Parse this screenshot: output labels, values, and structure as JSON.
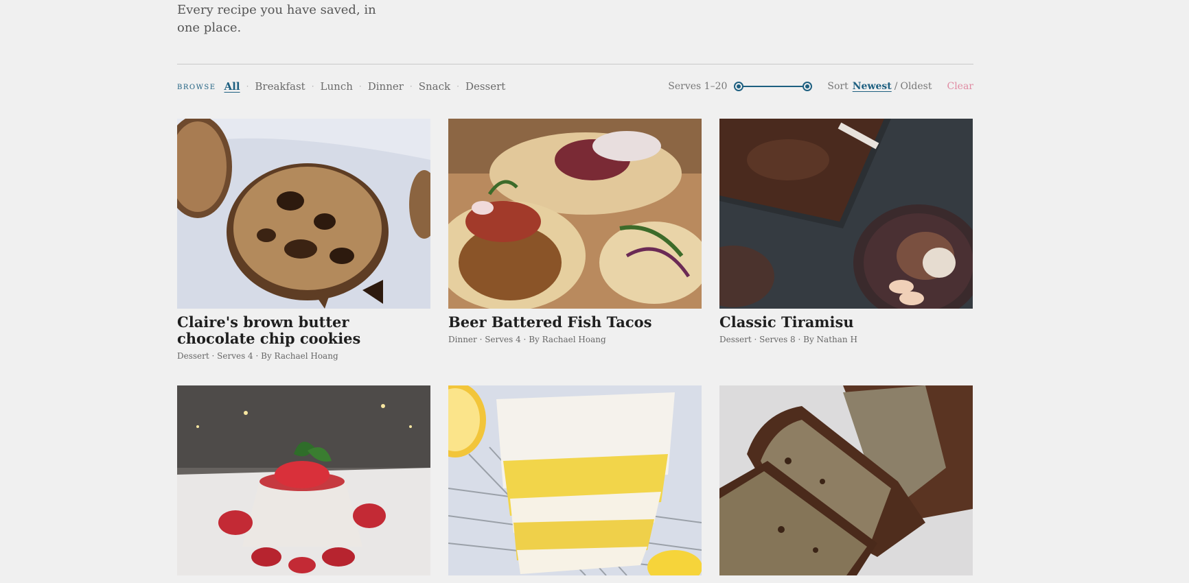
{
  "intro": {
    "text": "Every recipe you have saved, in one place."
  },
  "filters": {
    "browse_label": "Browse",
    "categories": [
      {
        "label": "All",
        "active": true
      },
      {
        "label": "Breakfast",
        "active": false
      },
      {
        "label": "Lunch",
        "active": false
      },
      {
        "label": "Dinner",
        "active": false
      },
      {
        "label": "Snack",
        "active": false
      },
      {
        "label": "Dessert",
        "active": false
      }
    ],
    "serves_label": "Serves 1–20",
    "serves_range": [
      1,
      20
    ],
    "sort_label": "Sort",
    "sort_newest": "Newest",
    "sort_oldest": "Oldest",
    "sort_active": "Newest",
    "clear_label": "Clear"
  },
  "recipes": [
    {
      "title": "Claire's brown butter chocolate chip cookies",
      "meta": "Dessert · Serves 4 · By Rachael Hoang",
      "image": "cookies"
    },
    {
      "title": "Beer Battered Fish Tacos",
      "meta": "Dinner · Serves 4 · By Rachael Hoang",
      "image": "tacos"
    },
    {
      "title": "Classic Tiramisu",
      "meta": "Dessert · Serves 8 · By Nathan H",
      "image": "tiramisu"
    },
    {
      "title": "",
      "meta": "",
      "image": "panna-cotta"
    },
    {
      "title": "",
      "meta": "",
      "image": "lemon-bars"
    },
    {
      "title": "",
      "meta": "",
      "image": "banana-bread"
    }
  ],
  "colors": {
    "accent": "#1d5f80",
    "clear": "#e08aa2",
    "background": "#f0f0f0"
  }
}
